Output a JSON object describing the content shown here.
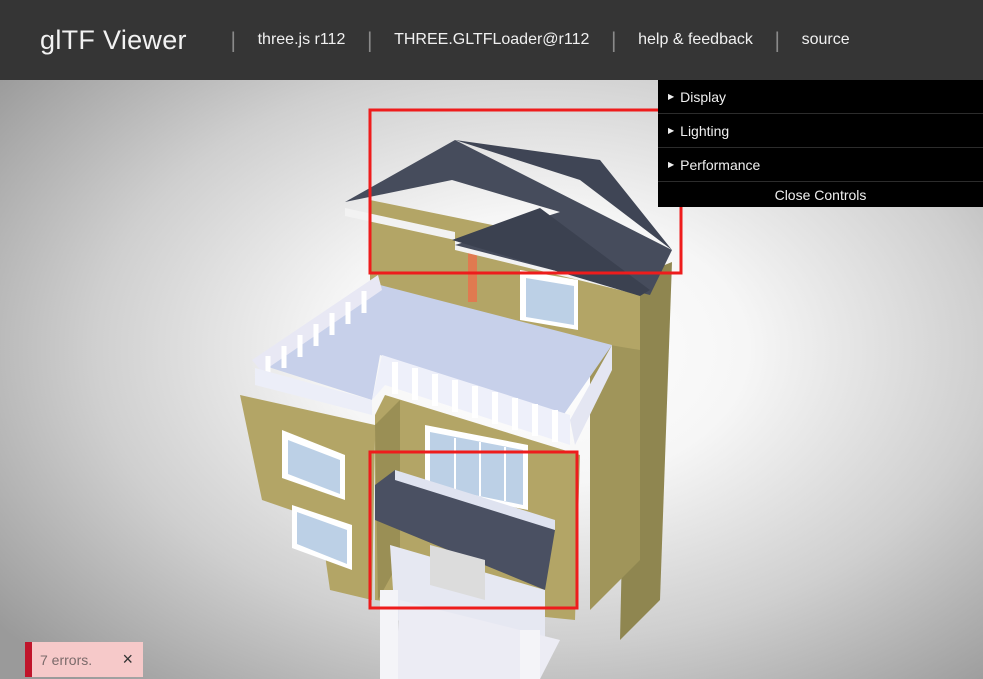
{
  "header": {
    "title": "glTF Viewer",
    "links": [
      "three.js r112",
      "THREE.GLTFLoader@r112",
      "help & feedback",
      "source"
    ]
  },
  "controls": {
    "folders": [
      "Display",
      "Lighting",
      "Performance"
    ],
    "close_label": "Close Controls"
  },
  "errors": {
    "text": "7 errors.",
    "dismiss": "×"
  },
  "colors": {
    "header_bg": "#353535",
    "roof": "#464c5c",
    "wall": "#b3a566",
    "terrace": "#c7d0ea",
    "highlight": "#ee1c1c",
    "error_accent": "#c0152b"
  }
}
